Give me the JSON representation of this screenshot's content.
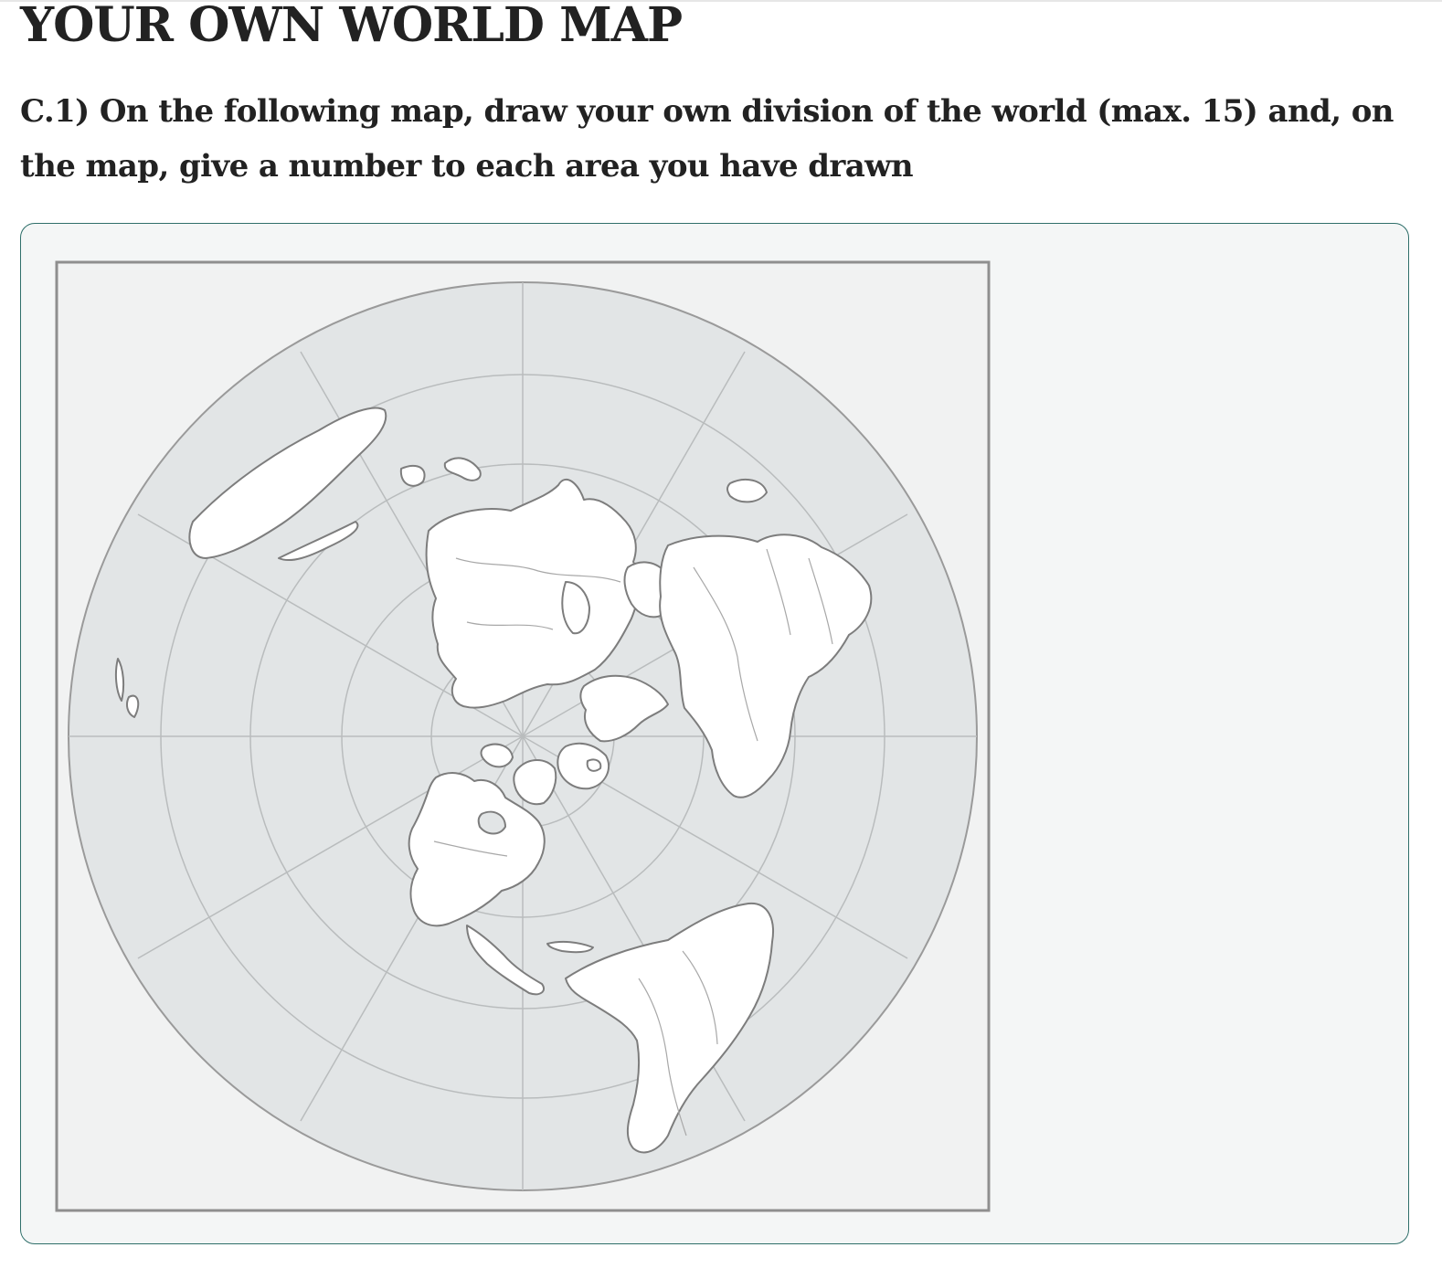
{
  "page": {
    "title": "YOUR OWN WORLD MAP"
  },
  "question": {
    "text": "C.1) On the following map, draw your own division of the world (max. 15) and, on the map, give a number to each area you have drawn"
  },
  "map": {
    "kind": "polar azimuthal world outline map (blank, for drawing)",
    "ocean_color": "#e2e5e6",
    "land_color": "#ffffff",
    "frame_color": "#8f8f8f",
    "panel_border_color": "#2f6f6a"
  }
}
